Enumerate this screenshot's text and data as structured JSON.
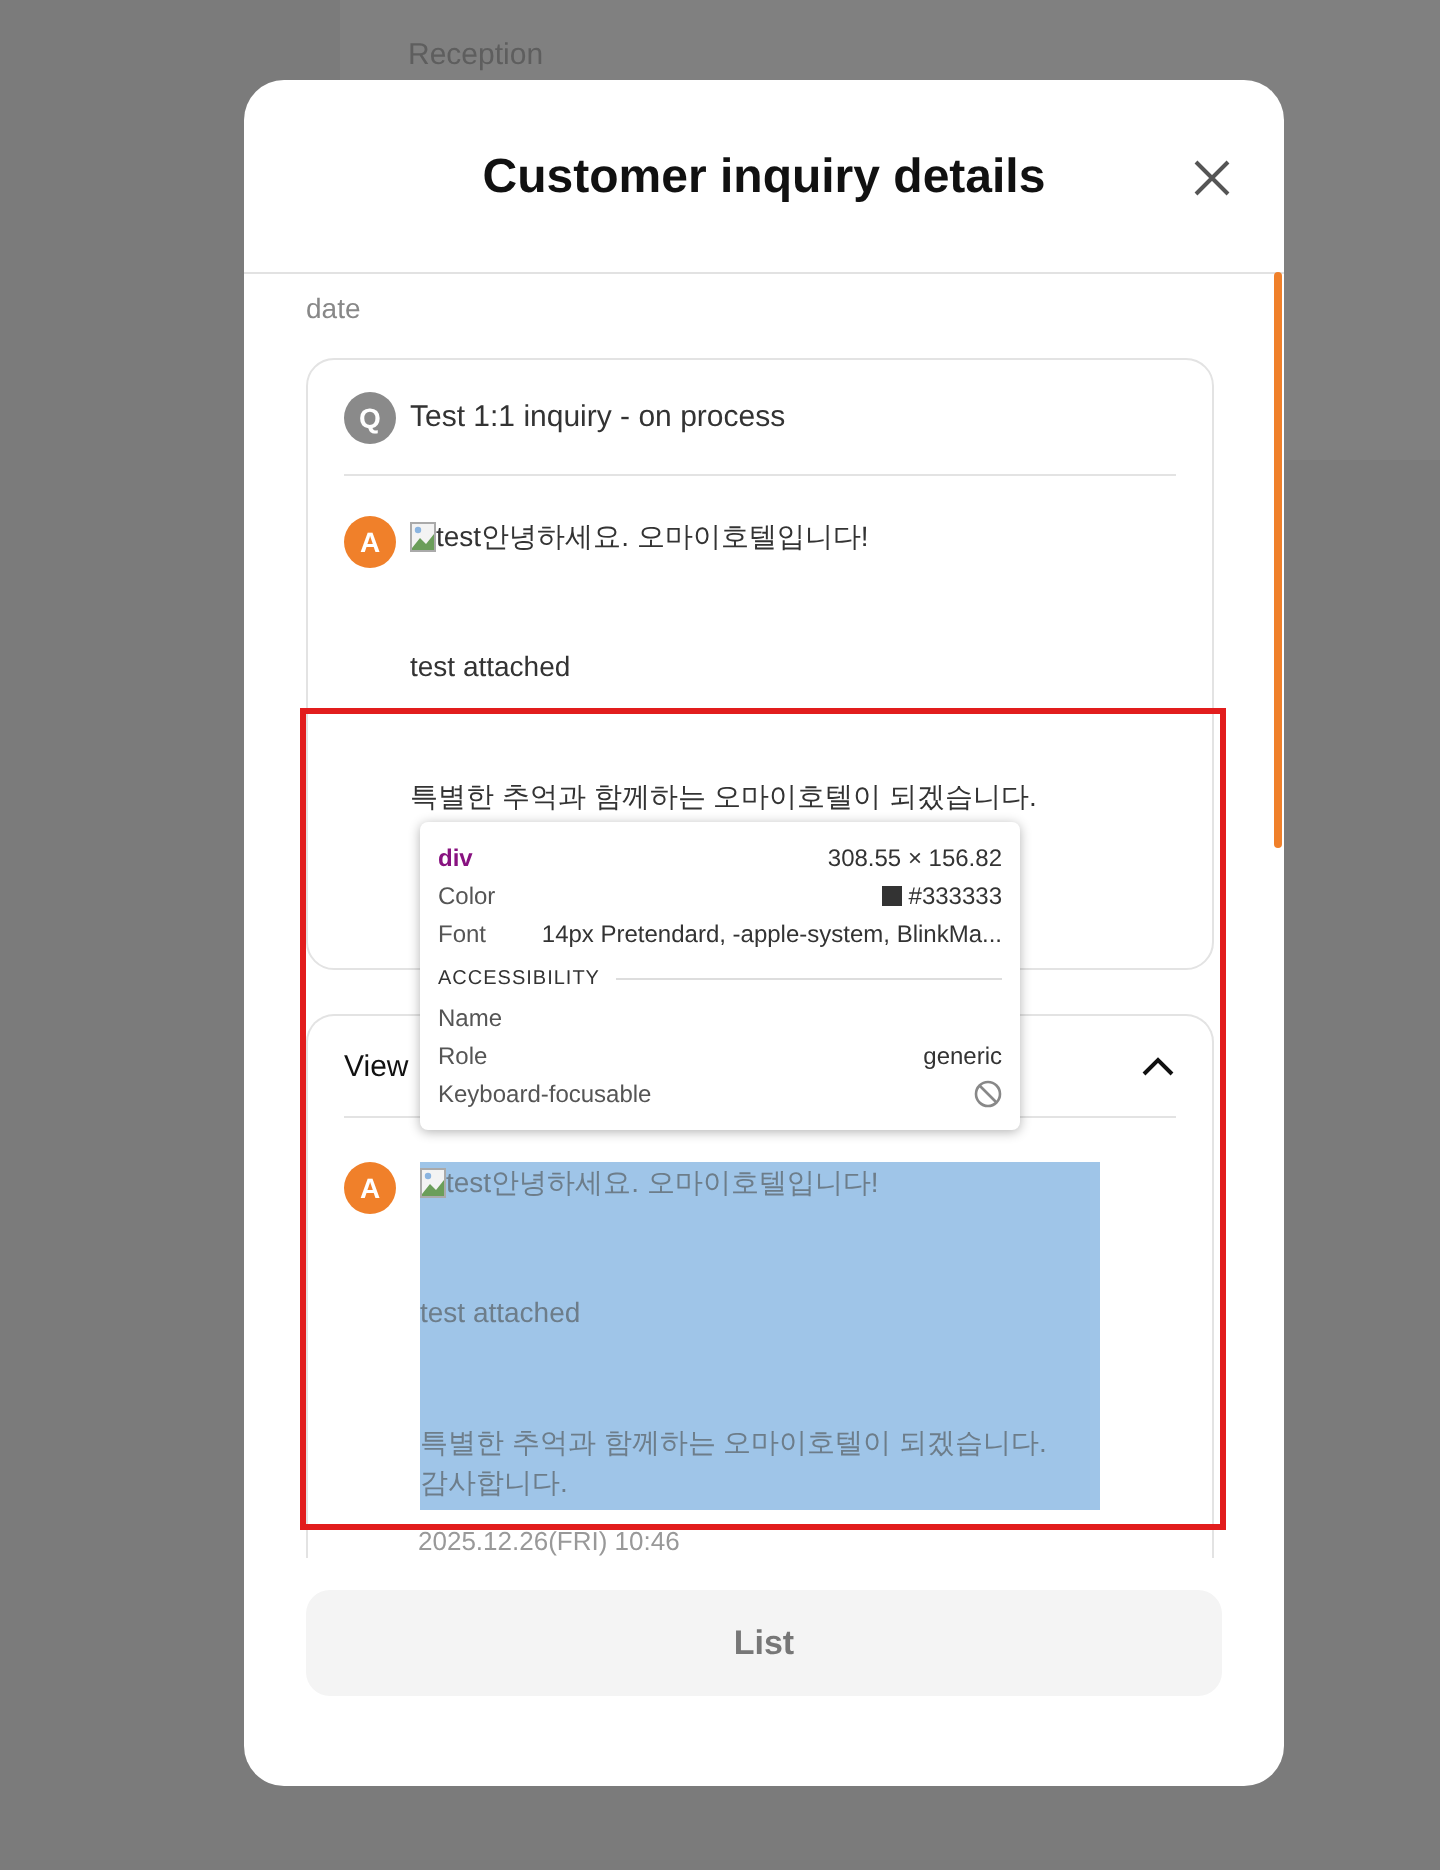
{
  "background_page": {
    "field_labels": [
      "Reception"
    ]
  },
  "modal": {
    "title": "Customer inquiry details",
    "previous_field": {
      "label": "date"
    },
    "inquiry_card": {
      "question_badge": "Q",
      "question": "Test 1:1 inquiry - on process",
      "answer_badge": "A",
      "answer_lines": [
        "test안녕하세요. 오마이호텔입니다!",
        "test attached",
        "특별한 추억과 함께하는 오마이호텔이 되겠습니다."
      ]
    },
    "history_card": {
      "title": "View",
      "expanded": true,
      "answer_badge": "A",
      "highlighted": true,
      "answer_lines": [
        "test안녕하세요. 오마이호텔입니다!",
        "test attached",
        "특별한 추억과 함께하는 오마이호텔이 되겠습니다.\n감사합니다."
      ],
      "date": "2025.12.26(FRI) 10:46"
    },
    "list_button": "List"
  },
  "inspector_tooltip": {
    "tag": "div",
    "size": "308.55 × 156.82",
    "style_rows": [
      {
        "label": "Color",
        "value": "#333333",
        "kind": "color"
      },
      {
        "label": "Font",
        "value": "14px Pretendard, -apple-system, BlinkMa...",
        "kind": "text"
      }
    ],
    "section": "ACCESSIBILITY",
    "a11y_rows": [
      {
        "label": "Name",
        "kind": "text"
      },
      {
        "label": "Role",
        "value": "generic",
        "kind": "text"
      },
      {
        "label": "Keyboard-focusable",
        "kind": "flag",
        "focusable": false
      }
    ]
  }
}
